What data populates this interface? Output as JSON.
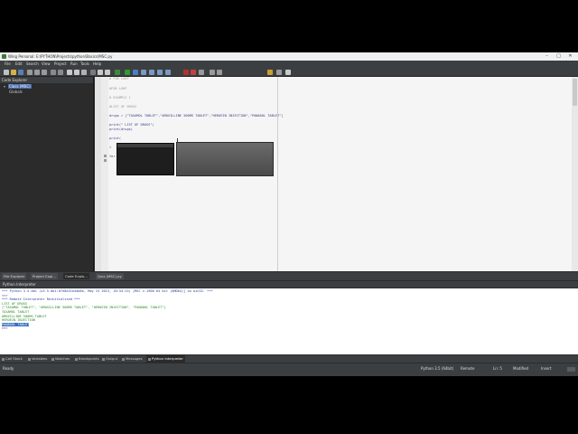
{
  "window": {
    "title": "Wing Personal: E:\\PYTHON\\Projects\\python\\Basics\\MSC.py"
  },
  "menubar": [
    "File",
    "Edit",
    "Search",
    "View",
    "Project",
    "Run",
    "Tools",
    "Help"
  ],
  "explorer": {
    "title": "Code Explorer",
    "items": [
      {
        "label": "Class (MSC)"
      },
      {
        "label": "Globals"
      }
    ]
  },
  "editor": {
    "lines": [
      "# FOR LOOP",
      "",
      "#FOR LOOP",
      "",
      "# EXAMPLE 1",
      "",
      "#LIST OF DRUGS",
      "",
      "drugs = [\"TAXAMOL TABLET\",\"AMOXILLINE 500MG TABLET\",\"HEROEIN INJECTION\",\"PANADOL TABLET\"]",
      "",
      "print(\" LIST OF DRUGS\")",
      "print(drugs)",
      "",
      "print(",
      "",
      "#",
      "",
      "for"
    ]
  },
  "panel_tabs": [
    "File Explorer",
    "Project Expl...",
    "Code Explo...",
    "Quiz (MSC).py"
  ],
  "interpreter": {
    "title": "Python Interpreter",
    "console": [
      {
        "text": "*** Python 3.5.0b1 (v3.5.0b1:07e8a31e4ab6e, May 23 2015, 16:54:15) [MSC v.1900 64 bit (AMD64)] on win32. ***",
        "style": "c-blue"
      },
      {
        "text": ">>>",
        "style": "c-blue"
      },
      {
        "text": "*** Remote Interpreter Reinitialized  ***",
        "style": "c-blue"
      },
      {
        "text": " LIST OF DRUGS",
        "style": "c-green"
      },
      {
        "text": "[\"TAXAMOL TABLET\", \"AMOXILLINE 500MG TABLET\", \"HEROEIN INJECTION\", \"PANADOL TABLET\"]",
        "style": "c-green"
      },
      {
        "text": "TAXAMOL TABLET",
        "style": "c-green"
      },
      {
        "text": "AMOXILLINE 500MG TABLET",
        "style": "c-green"
      },
      {
        "text": "HEROEIN INJECTION",
        "style": "c-green"
      },
      {
        "text": "PANADOL TABLET",
        "style": "c-hl"
      },
      {
        "text": ">>>",
        "style": "c-dark"
      }
    ]
  },
  "bottom_tabs": [
    "Call Stack",
    "Variables",
    "Watches",
    "Breakpoints",
    "Output",
    "Messages",
    "Python Interpreter"
  ],
  "status": {
    "left": "Ready",
    "python": "Python 3.5 (64bit)",
    "remote": "Remote",
    "position": "Ln: 5",
    "modified": "Modified",
    "insert": "Insert"
  }
}
